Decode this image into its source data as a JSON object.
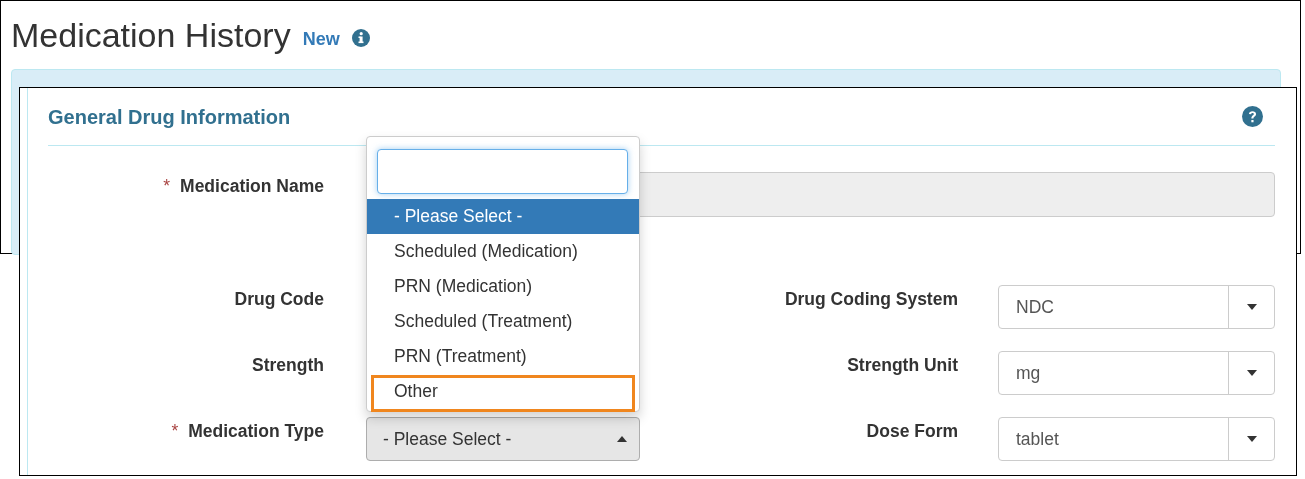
{
  "header": {
    "title": "Medication History",
    "link": "New"
  },
  "panel": {
    "title": "General Drug Information"
  },
  "name_field": {
    "label": "Medication Name",
    "marker": "*",
    "disabled": true
  },
  "left_fields": [
    {
      "label": "Drug Code",
      "kind": "covered"
    },
    {
      "label": "Strength",
      "kind": "covered"
    },
    {
      "label": "Medication Type",
      "marker": "*",
      "kind": "select",
      "value": "- Please Select -",
      "open": true
    }
  ],
  "right_fields": [
    {
      "label": "Drug Coding System",
      "value": "NDC"
    },
    {
      "label": "Strength Unit",
      "value": "mg"
    },
    {
      "label": "Dose Form",
      "value": "tablet"
    }
  ],
  "dropdown": {
    "options": [
      {
        "label": "- Please Select -",
        "selected": true,
        "outlined": false
      },
      {
        "label": "Scheduled (Medication)",
        "selected": false,
        "outlined": false
      },
      {
        "label": "PRN (Medication)",
        "selected": false,
        "outlined": false
      },
      {
        "label": "Scheduled (Treatment)",
        "selected": false,
        "outlined": false
      },
      {
        "label": "PRN (Treatment)",
        "selected": false,
        "outlined": false
      },
      {
        "label": "Other",
        "selected": false,
        "outlined": true
      }
    ]
  }
}
